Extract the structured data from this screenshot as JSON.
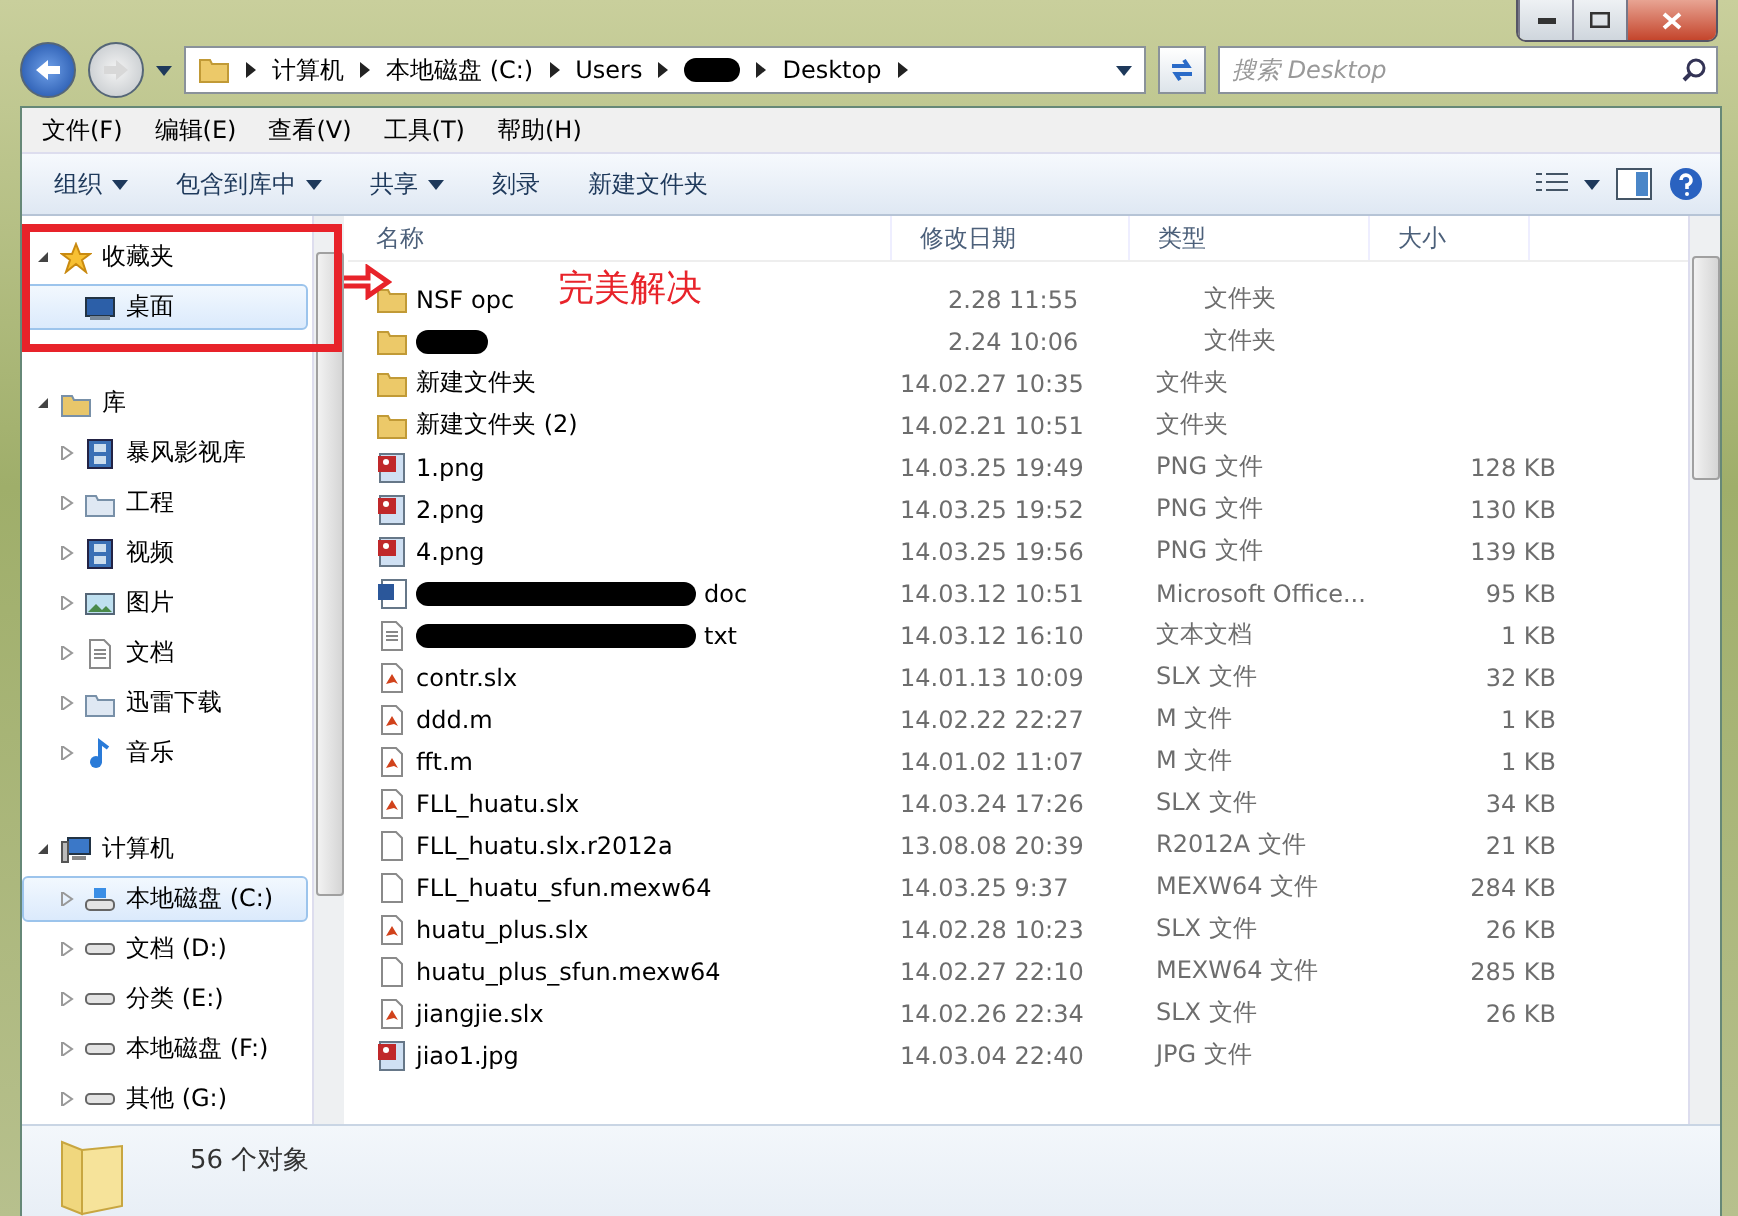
{
  "address": {
    "crumbs": [
      {
        "label": "计算机"
      },
      {
        "label": "本地磁盘 (C:)"
      },
      {
        "label": "Users"
      },
      {
        "redacted": true
      },
      {
        "label": "Desktop"
      }
    ]
  },
  "search": {
    "placeholder": "搜索 Desktop"
  },
  "menu": [
    "文件(F)",
    "编辑(E)",
    "查看(V)",
    "工具(T)",
    "帮助(H)"
  ],
  "toolbar": [
    {
      "label": "组织",
      "dropdown": true
    },
    {
      "label": "包含到库中",
      "dropdown": true
    },
    {
      "label": "共享",
      "dropdown": true
    },
    {
      "label": "刻录",
      "dropdown": false
    },
    {
      "label": "新建文件夹",
      "dropdown": false
    }
  ],
  "nav": [
    {
      "label": "收藏夹",
      "expanded": true,
      "selected": false,
      "children": [
        {
          "label": "桌面",
          "selected": true
        }
      ]
    },
    {
      "label": "库",
      "expanded": true,
      "selected": false,
      "children": [
        {
          "label": "暴风影视库",
          "selected": false
        },
        {
          "label": "工程",
          "selected": false
        },
        {
          "label": "视频",
          "selected": false
        },
        {
          "label": "图片",
          "selected": false
        },
        {
          "label": "文档",
          "selected": false
        },
        {
          "label": "迅雷下载",
          "selected": false
        },
        {
          "label": "音乐",
          "selected": false
        }
      ]
    },
    {
      "label": "计算机",
      "expanded": true,
      "selected": false,
      "children": [
        {
          "label": "本地磁盘 (C:)",
          "selected": true
        },
        {
          "label": "文档 (D:)",
          "selected": false
        },
        {
          "label": "分类 (E:)",
          "selected": false
        },
        {
          "label": "本地磁盘 (F:)",
          "selected": false
        },
        {
          "label": "其他 (G:)",
          "selected": false
        }
      ]
    }
  ],
  "columns": [
    "名称",
    "修改日期",
    "类型",
    "大小"
  ],
  "rows": [
    {
      "kind": "folder",
      "name": "NSF",
      "name_after_arrow": "opc",
      "date": "2.28 11:55",
      "type": "文件夹"
    },
    {
      "kind": "folder",
      "redacted": true,
      "date": "2.24 10:06",
      "type": "文件夹"
    },
    {
      "kind": "folder",
      "name": "新建文件夹",
      "date": "14.02.27 10:35",
      "type": "文件夹"
    },
    {
      "kind": "folder",
      "name": "新建文件夹 (2)",
      "date": "14.02.21 10:51",
      "type": "文件夹"
    },
    {
      "kind": "image",
      "name": "1.png",
      "date": "14.03.25 19:49",
      "type": "PNG 文件",
      "size": "128 KB"
    },
    {
      "kind": "image",
      "name": "2.png",
      "date": "14.03.25 19:52",
      "type": "PNG 文件",
      "size": "130 KB"
    },
    {
      "kind": "image",
      "name": "4.png",
      "date": "14.03.25 19:56",
      "type": "PNG 文件",
      "size": "139 KB"
    },
    {
      "kind": "word",
      "redacted": true,
      "name_tail": "doc",
      "date": "14.03.12 10:51",
      "type": "Microsoft Office...",
      "size": "95 KB"
    },
    {
      "kind": "text",
      "redacted": true,
      "name_tail": "txt",
      "date": "14.03.12 16:10",
      "type": "文本文档",
      "size": "1 KB"
    },
    {
      "kind": "matlab",
      "name": "contr.slx",
      "date": "14.01.13 10:09",
      "type": "SLX 文件",
      "size": "32 KB"
    },
    {
      "kind": "matlab",
      "name": "ddd.m",
      "date": "14.02.22 22:27",
      "type": "M 文件",
      "size": "1 KB"
    },
    {
      "kind": "matlab",
      "name": "fft.m",
      "date": "14.01.02 11:07",
      "type": "M 文件",
      "size": "1 KB"
    },
    {
      "kind": "matlab",
      "name": "FLL_huatu.slx",
      "date": "14.03.24 17:26",
      "type": "SLX 文件",
      "size": "34 KB"
    },
    {
      "kind": "blank",
      "name": "FLL_huatu.slx.r2012a",
      "date": "13.08.08 20:39",
      "type": "R2012A 文件",
      "size": "21 KB"
    },
    {
      "kind": "blank",
      "name": "FLL_huatu_sfun.mexw64",
      "date": "14.03.25 9:37",
      "type": "MEXW64 文件",
      "size": "284 KB"
    },
    {
      "kind": "matlab",
      "name": "huatu_plus.slx",
      "date": "14.02.28 10:23",
      "type": "SLX 文件",
      "size": "26 KB"
    },
    {
      "kind": "blank",
      "name": "huatu_plus_sfun.mexw64",
      "date": "14.02.27 22:10",
      "type": "MEXW64 文件",
      "size": "285 KB"
    },
    {
      "kind": "matlab",
      "name": "jiangjie.slx",
      "date": "14.02.26 22:34",
      "type": "SLX 文件",
      "size": "26 KB"
    },
    {
      "kind": "image",
      "name": "jiao1.jpg",
      "date": "14.03.04 22:40",
      "type": "JPG 文件"
    }
  ],
  "status": {
    "count": "56 个对象"
  },
  "annotation": {
    "text": "完美解决"
  }
}
